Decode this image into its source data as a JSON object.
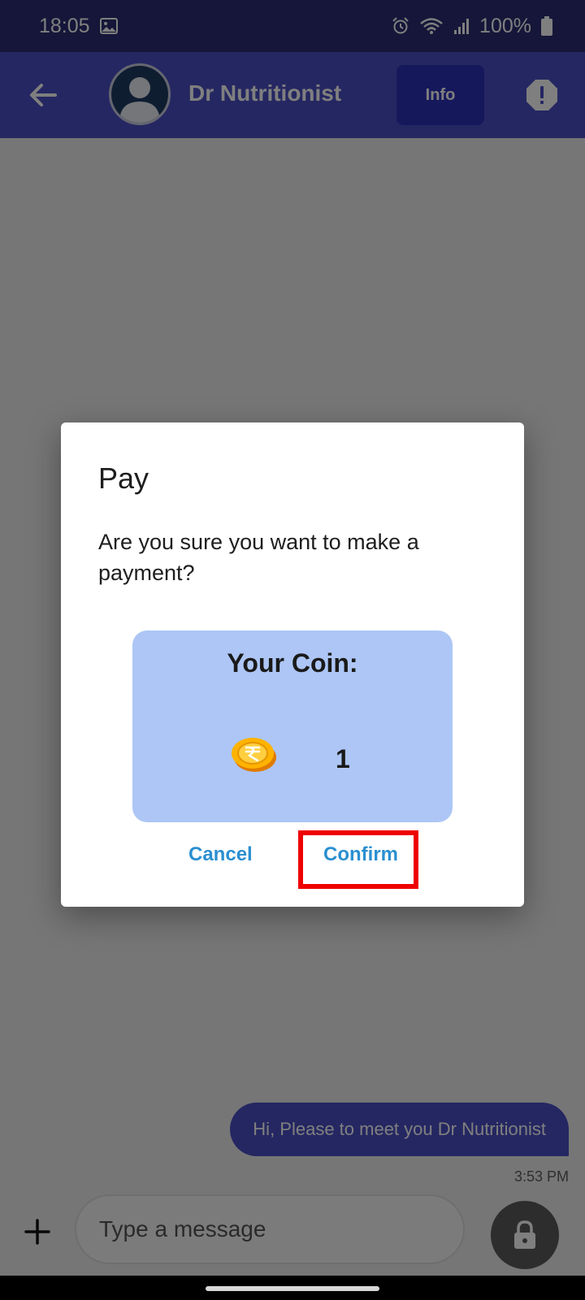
{
  "status_bar": {
    "time": "18:05",
    "battery": "100%"
  },
  "app_bar": {
    "contact_name": "Dr Nutritionist",
    "info_label": "Info"
  },
  "chat": {
    "messages": [
      {
        "text": "Hi, Please to meet you Dr Nutritionist",
        "time": "3:53 PM"
      }
    ]
  },
  "input": {
    "placeholder": "Type a message"
  },
  "dialog": {
    "title": "Pay",
    "message": "Are you sure you want to make a payment?",
    "coin_card_title": "Your Coin:",
    "coin_count": "1",
    "cancel_label": "Cancel",
    "confirm_label": "Confirm"
  },
  "colors": {
    "app_bar": "#4a4fc4",
    "status_bar": "#2a2d72",
    "info_button": "#2d31b8",
    "coin_card": "#adc6f5",
    "dialog_button_text": "#2b8fd0",
    "highlight": "#ee0000"
  },
  "icons": {
    "status": [
      "gallery-icon",
      "alarm-icon",
      "wifi-icon",
      "signal-icon",
      "battery-icon"
    ],
    "app_bar": [
      "back-arrow-icon",
      "avatar-person-icon",
      "alert-icon"
    ],
    "input_bar": [
      "plus-icon",
      "lock-icon"
    ],
    "coin": "coin-icon"
  }
}
